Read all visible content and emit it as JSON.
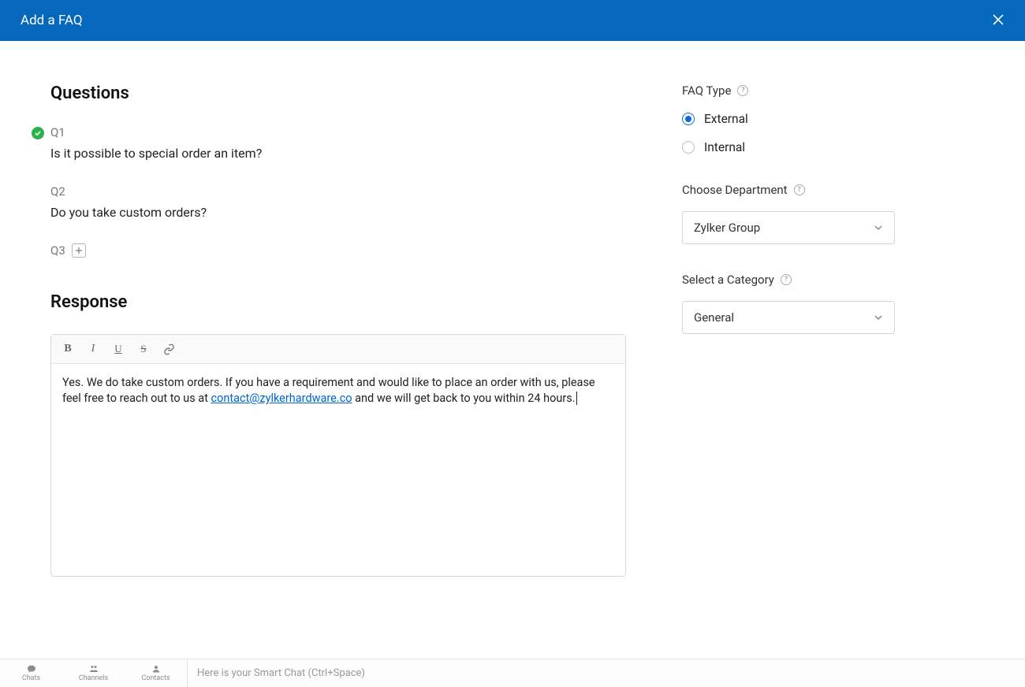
{
  "header": {
    "title": "Add a FAQ"
  },
  "questions": {
    "title": "Questions",
    "items": [
      {
        "label": "Q1",
        "text": "Is it possible to special order an item?",
        "checked": true
      },
      {
        "label": "Q2",
        "text": "Do you take custom orders?",
        "checked": false
      },
      {
        "label": "Q3",
        "text": "",
        "checked": false
      }
    ]
  },
  "response": {
    "title": "Response",
    "text_pre": "Yes. We do take custom orders. If you have a requirement and would like to place an order with us, please feel free to reach out to us at ",
    "email": "contact@zylkerhardware.co",
    "text_post": " and we will get back to you within 24 hours. "
  },
  "sidebar": {
    "faq_type_label": "FAQ Type",
    "faq_type_options": [
      {
        "label": "External",
        "selected": true
      },
      {
        "label": "Internal",
        "selected": false
      }
    ],
    "department_label": "Choose Department",
    "department_value": "Zylker Group",
    "category_label": "Select a Category",
    "category_value": "General"
  },
  "bottombar": {
    "tabs": [
      {
        "label": "Chats"
      },
      {
        "label": "Channels"
      },
      {
        "label": "Contacts"
      }
    ],
    "smart_text": "Here is your Smart Chat (Ctrl+Space)"
  }
}
